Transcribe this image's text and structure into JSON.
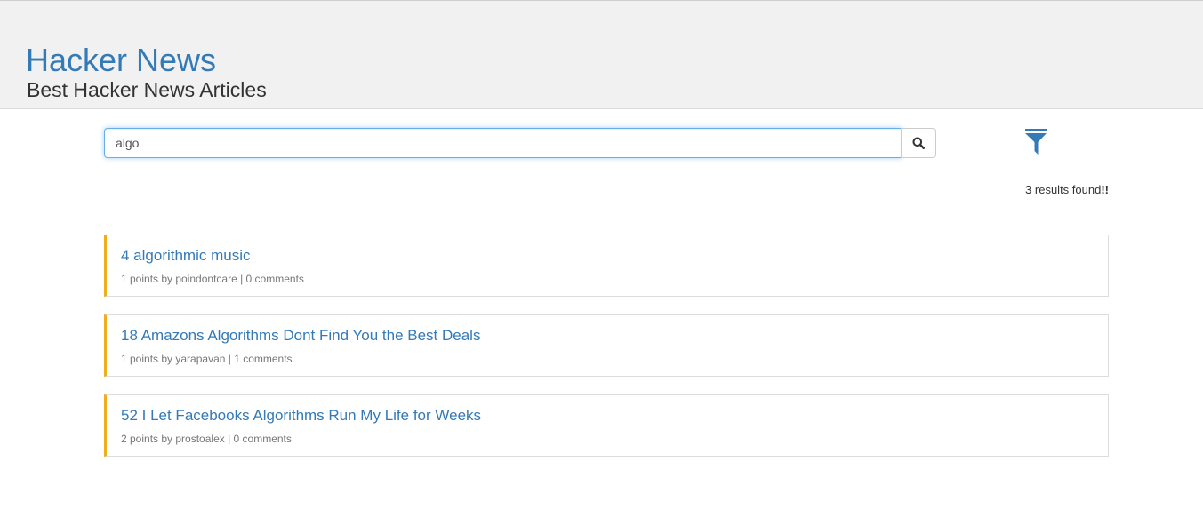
{
  "header": {
    "title": "Hacker News",
    "subtitle": "Best Hacker News Articles"
  },
  "search": {
    "value": "algo",
    "button_icon": "search-icon"
  },
  "filter": {
    "icon": "filter-icon",
    "color": "#337ab7"
  },
  "results": {
    "count_text": "3 results found",
    "count_suffix": "!!",
    "items": [
      {
        "title": "4 algorithmic music",
        "meta": "1 points by poindontcare | 0 comments"
      },
      {
        "title": "18 Amazons Algorithms Dont Find You the Best Deals",
        "meta": "1 points by yarapavan | 1 comments"
      },
      {
        "title": "52 I Let Facebooks Algorithms Run My Life for Weeks",
        "meta": "2 points by prostoalex | 0 comments"
      }
    ]
  },
  "colors": {
    "accent": "#337ab7",
    "card_border_left": "#f0ad1c",
    "header_bg": "#f1f1f1"
  }
}
